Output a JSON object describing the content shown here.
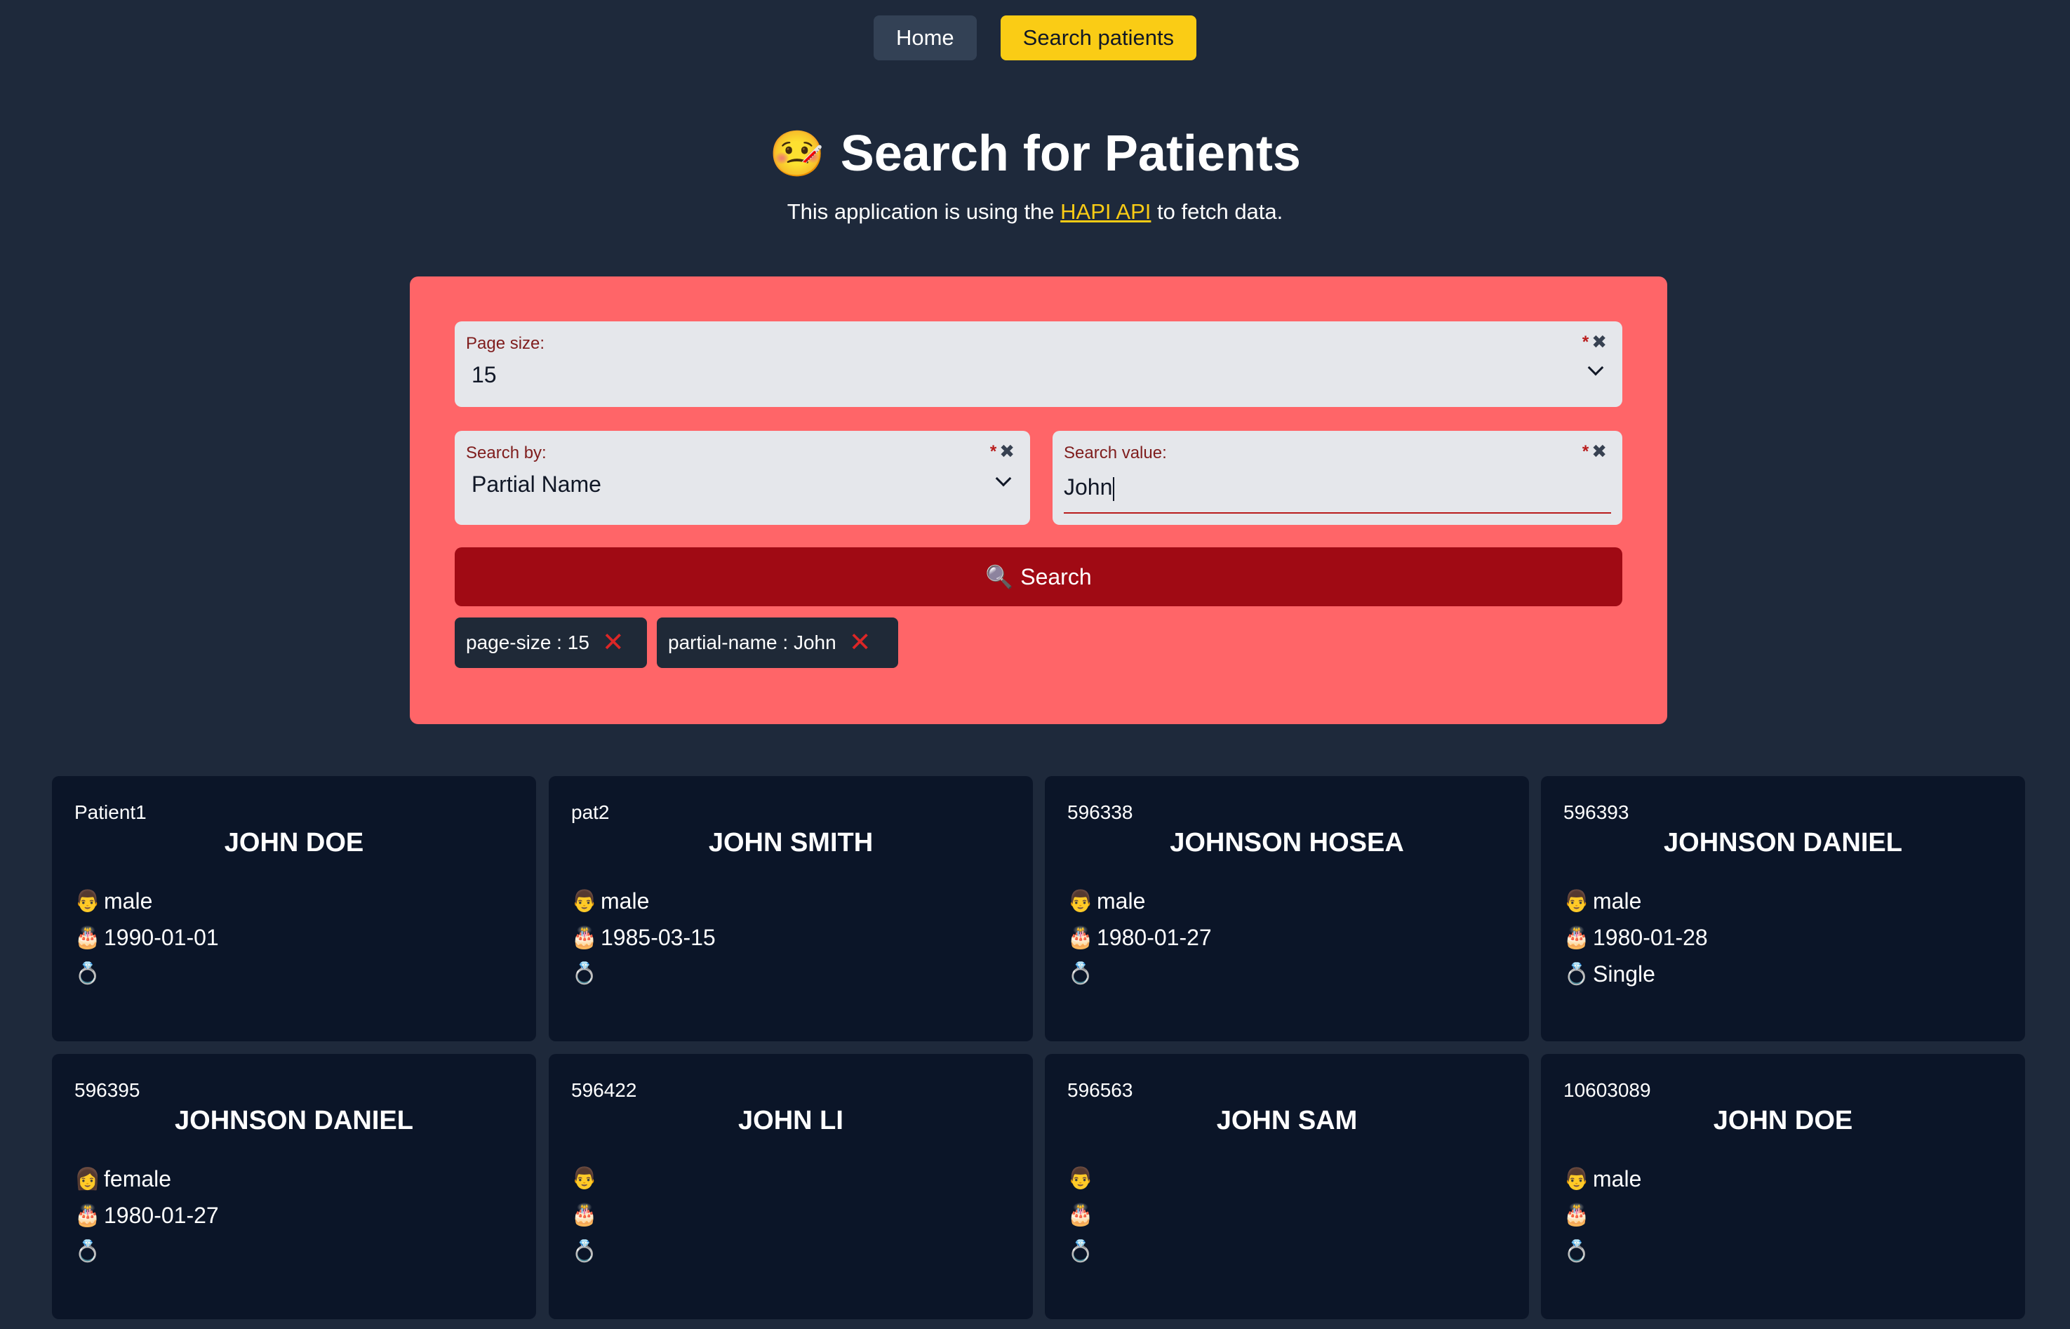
{
  "nav": {
    "home_label": "Home",
    "search_label": "Search patients"
  },
  "header": {
    "title_icon": "🤒",
    "title": "Search for Patients",
    "subtitle_before": "This application is using the",
    "subtitle_link": "HAPI API",
    "subtitle_after": "to fetch data."
  },
  "form": {
    "page_size": {
      "label": "Page size:",
      "value": "15",
      "required": "*",
      "clear": "✖"
    },
    "search_by": {
      "label": "Search by:",
      "value": "Partial Name",
      "required": "*",
      "clear": "✖"
    },
    "search_value": {
      "label": "Search value:",
      "value": "John",
      "required": "*",
      "clear": "✖"
    },
    "search_button": {
      "icon": "🔍",
      "label": "Search"
    },
    "chips": [
      {
        "label": "page-size : 15",
        "remove": "✕"
      },
      {
        "label": "partial-name : John",
        "remove": "✕"
      }
    ]
  },
  "icons": {
    "male": "👨",
    "female": "👩",
    "birthday": "🎂",
    "marital": "💍"
  },
  "patients": [
    {
      "id": "Patient1",
      "name": "JOHN DOE",
      "gender": "male",
      "birth_date": "1990-01-01",
      "marital": ""
    },
    {
      "id": "pat2",
      "name": "JOHN SMITH",
      "gender": "male",
      "birth_date": "1985-03-15",
      "marital": ""
    },
    {
      "id": "596338",
      "name": "JOHNSON HOSEA",
      "gender": "male",
      "birth_date": "1980-01-27",
      "marital": ""
    },
    {
      "id": "596393",
      "name": "JOHNSON DANIEL",
      "gender": "male",
      "birth_date": "1980-01-28",
      "marital": "Single"
    },
    {
      "id": "596395",
      "name": "JOHNSON DANIEL",
      "gender": "female",
      "birth_date": "1980-01-27",
      "marital": ""
    },
    {
      "id": "596422",
      "name": "JOHN LI",
      "gender": "",
      "birth_date": "",
      "marital": ""
    },
    {
      "id": "596563",
      "name": "JOHN SAM",
      "gender": "",
      "birth_date": "",
      "marital": ""
    },
    {
      "id": "10603089",
      "name": "JOHN DOE",
      "gender": "male",
      "birth_date": "",
      "marital": ""
    }
  ]
}
